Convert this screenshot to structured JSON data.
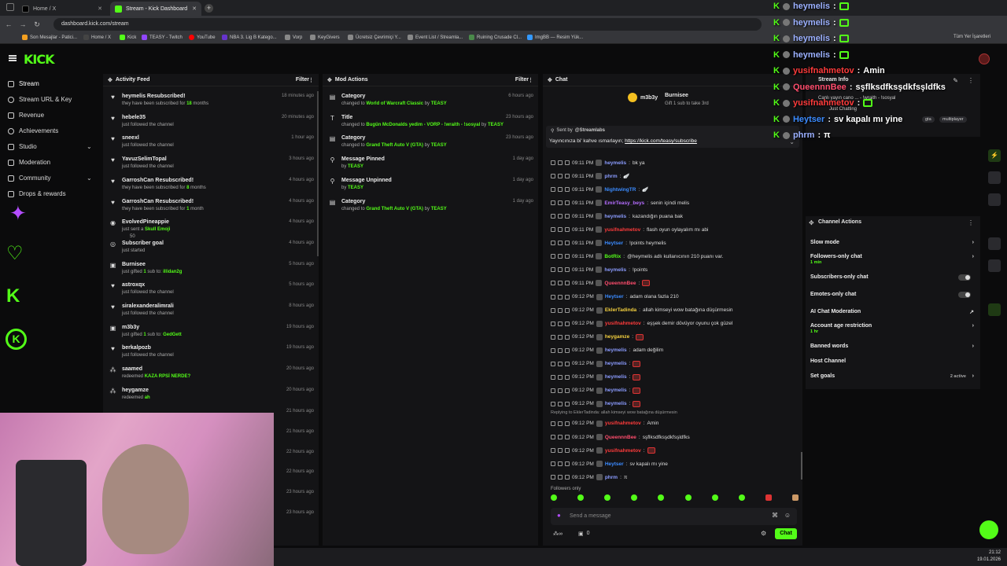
{
  "browser": {
    "tabs": [
      {
        "label": "Home / X",
        "active": false,
        "color": "#000000"
      },
      {
        "label": "Stream - Kick Dashboard",
        "active": true,
        "color": "#53fc18"
      }
    ],
    "url": "dashboard.kick.com/stream",
    "bookmarks": [
      {
        "label": "Son Mesajlar - Patici...",
        "color": "#f4a020"
      },
      {
        "label": "Home / X",
        "color": "#444444"
      },
      {
        "label": "Kick",
        "color": "#53fc18"
      },
      {
        "label": "TEASY - Twitch",
        "color": "#9146ff"
      },
      {
        "label": "YouTube",
        "color": "#ff0000"
      },
      {
        "label": "NBA 3. Lig B Katego...",
        "color": "#6633cc"
      },
      {
        "label": "Vorp",
        "color": "#888888"
      },
      {
        "label": "KeyGivers",
        "color": "#888888"
      },
      {
        "label": "Ücretsiz Çevrimiçi Y...",
        "color": "#888888"
      },
      {
        "label": "Event List / Streamla...",
        "color": "#888888"
      },
      {
        "label": "Ruining Crusade Cl...",
        "color": "#4a8a4a"
      },
      {
        "label": "ImgBB — Resim Yük...",
        "color": "#3399ff"
      }
    ],
    "bookmarks_right": "Tüm Yer İşaretleri"
  },
  "logo": "KICK",
  "sidebar": {
    "items": [
      {
        "label": "Stream"
      },
      {
        "label": "Stream URL & Key"
      },
      {
        "label": "Revenue"
      },
      {
        "label": "Achievements"
      },
      {
        "label": "Studio"
      },
      {
        "label": "Moderation"
      },
      {
        "label": "Community"
      },
      {
        "label": "Drops & rewards"
      }
    ]
  },
  "activity": {
    "title": "Activity Feed",
    "filter": "Filter",
    "rows": [
      {
        "icon": "♥",
        "name": "heymelis Resubscribed!",
        "pre": "they have been subscribed for ",
        "hl": "18",
        "post": " months",
        "time": "18 minutes ago"
      },
      {
        "icon": "♥",
        "name": "hebele35",
        "pre": "just followed the channel",
        "hl": "",
        "post": "",
        "time": "20 minutes ago"
      },
      {
        "icon": "♥",
        "name": "sneexl",
        "pre": "just followed the channel",
        "hl": "",
        "post": "",
        "time": "1 hour ago"
      },
      {
        "icon": "♥",
        "name": "YavuzSelimTopal",
        "pre": "just followed the channel",
        "hl": "",
        "post": "",
        "time": "3 hours ago"
      },
      {
        "icon": "♥",
        "name": "GarroshCan Resubscribed!",
        "pre": "they have been subscribed for ",
        "hl": "8",
        "post": " months",
        "time": "4 hours ago"
      },
      {
        "icon": "♥",
        "name": "GarroshCan Resubscribed!",
        "pre": "they have been subscribed for ",
        "hl": "1",
        "post": " month",
        "time": "4 hours ago"
      },
      {
        "icon": "◉",
        "name": "EvolvedPineappie",
        "pre": "just sent a ",
        "hl": "Skull Emoji",
        "post": "",
        "time": "4 hours ago",
        "extra": "50"
      },
      {
        "icon": "◎",
        "name": "Subscriber goal",
        "pre": "just started",
        "hl": "",
        "post": "",
        "time": "4 hours ago"
      },
      {
        "icon": "▣",
        "name": "Burnisee",
        "pre": "just gifted ",
        "hl": "1",
        "post": " sub to: ",
        "hl2": "illidan2g",
        "time": "5 hours ago"
      },
      {
        "icon": "♥",
        "name": "astroxqx",
        "pre": "just followed the channel",
        "hl": "",
        "post": "",
        "time": "5 hours ago"
      },
      {
        "icon": "♥",
        "name": "siralexanderalimrali",
        "pre": "just followed the channel",
        "hl": "",
        "post": "",
        "time": "8 hours ago"
      },
      {
        "icon": "▣",
        "name": "m3b3y",
        "pre": "just gifted ",
        "hl": "1",
        "post": " sub to: ",
        "hl2": "GedGett",
        "time": "19 hours ago"
      },
      {
        "icon": "♥",
        "name": "berkalpozb",
        "pre": "just followed the channel",
        "hl": "",
        "post": "",
        "time": "19 hours ago"
      },
      {
        "icon": "⁂",
        "name": "saamed",
        "pre": "redeemed ",
        "hl": "KAZA RPSİ NERDE?",
        "post": "",
        "time": "20 hours ago"
      },
      {
        "icon": "⁂",
        "name": "heygamze",
        "pre": "redeemed ",
        "hl": "ah",
        "post": "",
        "time": "20 hours ago"
      }
    ],
    "extra_times": [
      "21 hours ago",
      "21 hours ago",
      "22 hours ago",
      "22 hours ago",
      "23 hours ago",
      "23 hours ago"
    ]
  },
  "mod": {
    "title": "Mod Actions",
    "filter": "Filter",
    "rows": [
      {
        "icon": "▤",
        "name": "Category",
        "pre": "changed to ",
        "hl": "World of Warcraft Classic",
        "post": " by ",
        "hl2": "TEASY",
        "time": "6 hours ago"
      },
      {
        "icon": "T",
        "name": "Title",
        "pre": "changed to ",
        "hl": "Bugün McDonalds yedim - VORP - !wraith - !sosyal",
        "post": " by ",
        "hl2": "TEASY",
        "time": "23 hours ago"
      },
      {
        "icon": "▤",
        "name": "Category",
        "pre": "changed to ",
        "hl": "Grand Theft Auto V (GTA)",
        "post": " by ",
        "hl2": "TEASY",
        "time": "23 hours ago"
      },
      {
        "icon": "⚲",
        "name": "Message Pinned",
        "pre": "by ",
        "hl": "TEASY",
        "post": "",
        "time": "1 day ago"
      },
      {
        "icon": "⚲",
        "name": "Message Unpinned",
        "pre": "by ",
        "hl": "TEASY",
        "post": "",
        "time": "1 day ago"
      },
      {
        "icon": "▤",
        "name": "Category",
        "pre": "changed to ",
        "hl": "Grand Theft Auto V (GTA)",
        "post": " by ",
        "hl2": "TEASY",
        "time": "1 day ago"
      }
    ]
  },
  "chat": {
    "title": "Chat",
    "gift_user": "m3b3y",
    "gift_user2": "Burnisee",
    "gift_text": "Gift 1 sub to take 3rd",
    "pinned_sender": "Sent by",
    "pinned_by": "@Streamlabs",
    "pinned_text": "Yayıncınıza bi' kahve ısmarlayın;",
    "pinned_link": "https://kick.com/teasy/subscribe",
    "messages": [
      {
        "time": "09:11 PM",
        "user": "heymelis",
        "color": "#8b9cff",
        "text": "bk ya"
      },
      {
        "time": "09:11 PM",
        "user": "phrm",
        "color": "#8b9cff",
        "text": "🪽"
      },
      {
        "time": "09:11 PM",
        "user": "NightwingTR",
        "color": "#3b8bff",
        "text": "🪽"
      },
      {
        "time": "09:11 PM",
        "user": "EmirTeasy_beys",
        "color": "#b56dff",
        "text": "senin içindi melis"
      },
      {
        "time": "09:11 PM",
        "user": "heymelis",
        "color": "#8b9cff",
        "text": "kazandığın puana bak"
      },
      {
        "time": "09:11 PM",
        "user": "yusifnahmetov",
        "color": "#ff3b3b",
        "text": "flash oyun oylayalım mı abi"
      },
      {
        "time": "09:11 PM",
        "user": "Heytser",
        "color": "#3b8bff",
        "text": "!points heymelis"
      },
      {
        "time": "09:11 PM",
        "user": "BotRix",
        "color": "#53fc18",
        "text": "@heymelis adlı kullanıcının 210 puanı var."
      },
      {
        "time": "09:11 PM",
        "user": "heymelis",
        "color": "#8b9cff",
        "text": "!points"
      },
      {
        "time": "09:11 PM",
        "user": "QueennnBee",
        "color": "#ff4d6d",
        "text": ""
      },
      {
        "time": "09:12 PM",
        "user": "Heytser",
        "color": "#3b8bff",
        "text": "adam olana fazla 210"
      },
      {
        "time": "09:12 PM",
        "user": "EklerTadinda",
        "color": "#f4d03f",
        "text": "allah kimseyi wow batağına düşürmesin"
      },
      {
        "time": "09:12 PM",
        "user": "yusifnahmetov",
        "color": "#ff3b3b",
        "text": "eşşek demir dövüyor oyunu çok güzel"
      },
      {
        "time": "09:12 PM",
        "user": "heygamze",
        "color": "#f4d03f",
        "text": ""
      },
      {
        "time": "09:12 PM",
        "user": "heymelis",
        "color": "#8b9cff",
        "text": "adam değilim"
      },
      {
        "time": "09:12 PM",
        "user": "heymelis",
        "color": "#8b9cff",
        "text": ""
      },
      {
        "time": "09:12 PM",
        "user": "heymelis",
        "color": "#8b9cff",
        "text": ""
      },
      {
        "time": "09:12 PM",
        "user": "heymelis",
        "color": "#8b9cff",
        "text": ""
      },
      {
        "time": "09:12 PM",
        "user": "heymelis",
        "color": "#8b9cff",
        "text": ""
      },
      {
        "time": "09:12 PM",
        "user": "yusifnahmetov",
        "color": "#ff3b3b",
        "text": "Amin"
      },
      {
        "time": "09:12 PM",
        "user": "QueennnBee",
        "color": "#ff4d6d",
        "text": "sşflksdfksşdkfsşldfks"
      },
      {
        "time": "09:12 PM",
        "user": "yusifnahmetov",
        "color": "#ff3b3b",
        "text": ""
      },
      {
        "time": "09:12 PM",
        "user": "Heytser",
        "color": "#3b8bff",
        "text": "sv kapalı mı yine"
      },
      {
        "time": "09:12 PM",
        "user": "phrm",
        "color": "#8b9cff",
        "text": "π"
      }
    ],
    "reply_note": "Replying to EklerTadinda: allah kimseyi wow batağına düşürmesin",
    "followers_only": "Followers only",
    "input_placeholder": "Send a message",
    "send_label": "Chat",
    "points": "0"
  },
  "overlay": {
    "lines": [
      {
        "user": "heymelis",
        "color": "#9bb0ff",
        "text": ""
      },
      {
        "user": "heymelis",
        "color": "#9bb0ff",
        "text": ""
      },
      {
        "user": "heymelis",
        "color": "#9bb0ff",
        "text": ""
      },
      {
        "user": "heymelis",
        "color": "#9bb0ff",
        "text": ""
      },
      {
        "user": "yusifnahmetov",
        "color": "#ff3b3b",
        "text": "Amin"
      },
      {
        "user": "QueennnBee",
        "color": "#ff4d6d",
        "text": "sşflksdfksşdkfsşldfks"
      },
      {
        "user": "yusifnahmetov",
        "color": "#ff3b3b",
        "text": ""
      },
      {
        "user": "Heytser",
        "color": "#3b8bff",
        "text": "sv kapalı mı yine"
      },
      {
        "user": "phrm",
        "color": "#9bb0ff",
        "text": "π"
      }
    ]
  },
  "stream_info": {
    "title": "Stream Info",
    "line": "Canlı yayın cano ... - !wraith - !sosyal",
    "just_chatting": "Just Chatting",
    "tags": [
      "gta",
      "multiplayer"
    ]
  },
  "channel_actions": {
    "title": "Channel Actions",
    "rows": [
      {
        "label": "Slow mode",
        "sub": "",
        "kind": "arrow"
      },
      {
        "label": "Followers-only chat",
        "sub": "1 min",
        "kind": "arrow"
      },
      {
        "label": "Subscribers-only chat",
        "sub": "",
        "kind": "toggle"
      },
      {
        "label": "Emotes-only chat",
        "sub": "",
        "kind": "toggle"
      },
      {
        "label": "AI Chat Moderation",
        "sub": "",
        "kind": "ext"
      },
      {
        "label": "Account age restriction",
        "sub": "1 hr",
        "kind": "arrow"
      },
      {
        "label": "Banned words",
        "sub": "",
        "kind": "arrow"
      },
      {
        "label": "Host Channel",
        "sub": "",
        "kind": "none"
      },
      {
        "label": "Set goals",
        "sub": "",
        "kind": "goals",
        "extra": "2 active"
      }
    ]
  },
  "taskbar": {
    "time": "21:12",
    "date": "19.01.2026"
  }
}
